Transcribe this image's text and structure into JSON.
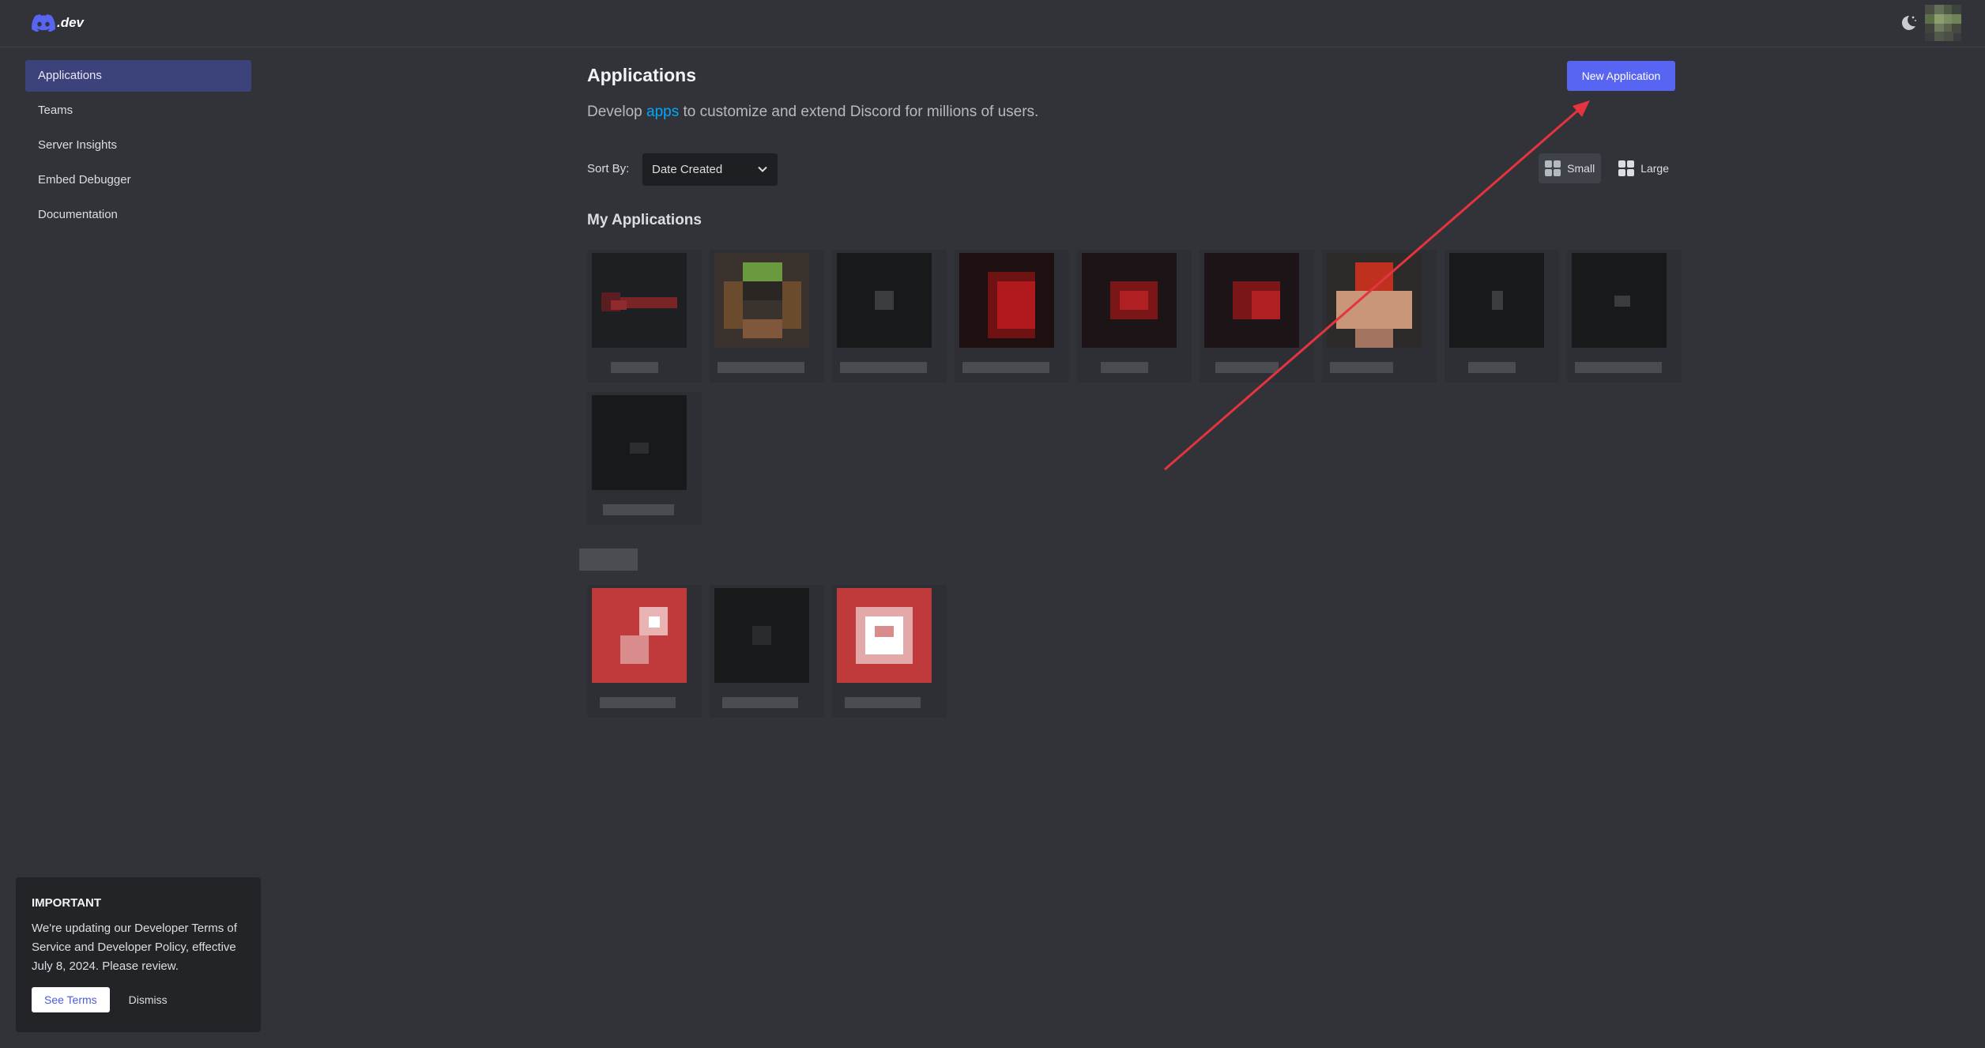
{
  "header": {
    "logo_text": ".dev",
    "logo_icon": "discord-logo-icon",
    "theme_icon": "moon-icon"
  },
  "sidebar": {
    "items": [
      {
        "label": "Applications",
        "active": true
      },
      {
        "label": "Teams"
      },
      {
        "label": "Server Insights"
      },
      {
        "label": "Embed Debugger"
      },
      {
        "label": "Documentation"
      }
    ]
  },
  "main": {
    "title": "Applications",
    "new_button": "New Application",
    "subtitle_pre": "Develop ",
    "subtitle_link": "apps",
    "subtitle_post": " to customize and extend Discord for millions of users.",
    "sort_label": "Sort By:",
    "sort_value": "Date Created",
    "view_small": "Small",
    "view_large": "Large",
    "section_title": "My Applications"
  },
  "notice": {
    "title": "IMPORTANT",
    "text": "We're updating our Developer Terms of Service and Developer Policy, effective July 8, 2024. Please review.",
    "see_terms": "See Terms",
    "dismiss": "Dismiss"
  },
  "colors": {
    "accent": "#5865f2",
    "link": "#00a8fc",
    "annotation_arrow": "#e5343f"
  }
}
